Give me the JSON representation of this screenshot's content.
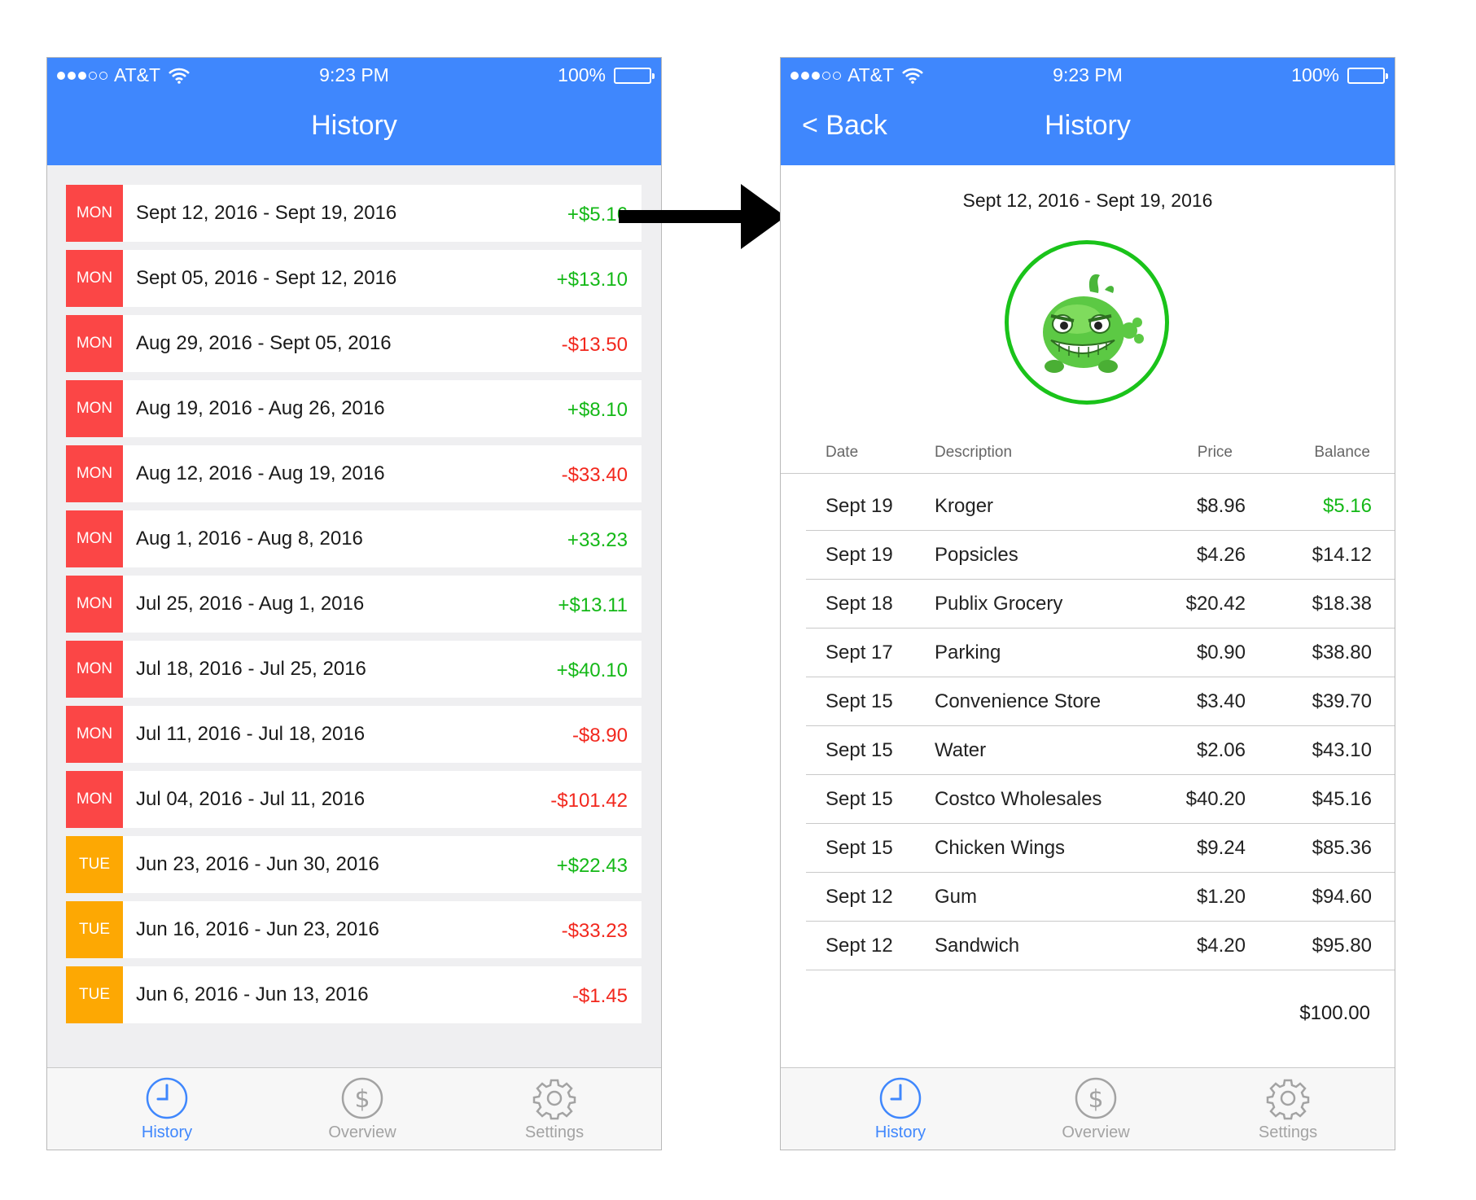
{
  "status_bar": {
    "carrier": "AT&T",
    "time": "9:23 PM",
    "battery": "100%"
  },
  "history_screen": {
    "title": "History",
    "weeks": [
      {
        "day": "MON",
        "range": "Sept 12, 2016 - Sept 19, 2016",
        "amount": "+$5.16",
        "sign": "pos"
      },
      {
        "day": "MON",
        "range": "Sept 05, 2016 - Sept 12, 2016",
        "amount": "+$13.10",
        "sign": "pos"
      },
      {
        "day": "MON",
        "range": "Aug 29, 2016 - Sept 05, 2016",
        "amount": "-$13.50",
        "sign": "neg"
      },
      {
        "day": "MON",
        "range": "Aug 19, 2016 - Aug 26, 2016",
        "amount": "+$8.10",
        "sign": "pos"
      },
      {
        "day": "MON",
        "range": "Aug 12, 2016 - Aug 19, 2016",
        "amount": "-$33.40",
        "sign": "neg"
      },
      {
        "day": "MON",
        "range": "Aug 1, 2016 - Aug 8, 2016",
        "amount": "+33.23",
        "sign": "pos"
      },
      {
        "day": "MON",
        "range": "Jul 25, 2016 - Aug 1, 2016",
        "amount": "+$13.11",
        "sign": "pos"
      },
      {
        "day": "MON",
        "range": "Jul 18, 2016 - Jul 25, 2016",
        "amount": "+$40.10",
        "sign": "pos"
      },
      {
        "day": "MON",
        "range": "Jul 11, 2016 - Jul 18, 2016",
        "amount": "-$8.90",
        "sign": "neg"
      },
      {
        "day": "MON",
        "range": "Jul 04, 2016 - Jul 11, 2016",
        "amount": "-$101.42",
        "sign": "neg"
      },
      {
        "day": "TUE",
        "range": "Jun 23, 2016 - Jun 30, 2016",
        "amount": "+$22.43",
        "sign": "pos"
      },
      {
        "day": "TUE",
        "range": "Jun 16, 2016 - Jun 23, 2016",
        "amount": "-$33.23",
        "sign": "neg"
      },
      {
        "day": "TUE",
        "range": "Jun 6, 2016 - Jun 13, 2016",
        "amount": "-$1.45",
        "sign": "neg"
      }
    ]
  },
  "detail_screen": {
    "back_label": "< Back",
    "title": "History",
    "range": "Sept 12, 2016 - Sept 19, 2016",
    "avatar_icon": "green-monster-icon",
    "columns": {
      "date": "Date",
      "description": "Description",
      "price": "Price",
      "balance": "Balance"
    },
    "transactions": [
      {
        "date": "Sept 19",
        "description": "Kroger",
        "price": "$8.96",
        "balance": "$5.16",
        "highlight": true
      },
      {
        "date": "Sept 19",
        "description": "Popsicles",
        "price": "$4.26",
        "balance": "$14.12"
      },
      {
        "date": "Sept 18",
        "description": "Publix Grocery",
        "price": "$20.42",
        "balance": "$18.38"
      },
      {
        "date": "Sept 17",
        "description": "Parking",
        "price": "$0.90",
        "balance": "$38.80"
      },
      {
        "date": "Sept 15",
        "description": "Convenience Store",
        "price": "$3.40",
        "balance": "$39.70"
      },
      {
        "date": "Sept 15",
        "description": "Water",
        "price": "$2.06",
        "balance": "$43.10"
      },
      {
        "date": "Sept 15",
        "description": "Costco Wholesales",
        "price": "$40.20",
        "balance": "$45.16"
      },
      {
        "date": "Sept 15",
        "description": "Chicken Wings",
        "price": "$9.24",
        "balance": "$85.36"
      },
      {
        "date": "Sept 12",
        "description": "Gum",
        "price": "$1.20",
        "balance": "$94.60"
      },
      {
        "date": "Sept 12",
        "description": "Sandwich",
        "price": "$4.20",
        "balance": "$95.80"
      }
    ],
    "starting_balance": "$100.00"
  },
  "tab_bar": {
    "tabs": [
      {
        "label": "History",
        "icon": "clock-icon",
        "active": true
      },
      {
        "label": "Overview",
        "icon": "dollar-icon",
        "active": false
      },
      {
        "label": "Settings",
        "icon": "gear-icon",
        "active": false
      }
    ]
  },
  "colors": {
    "brand_blue": "#3f87fd",
    "monday_badge": "#fb4646",
    "tuesday_badge": "#fda803",
    "positive": "#14b817",
    "negative": "#f2271d",
    "avatar_ring": "#1ac31a"
  }
}
